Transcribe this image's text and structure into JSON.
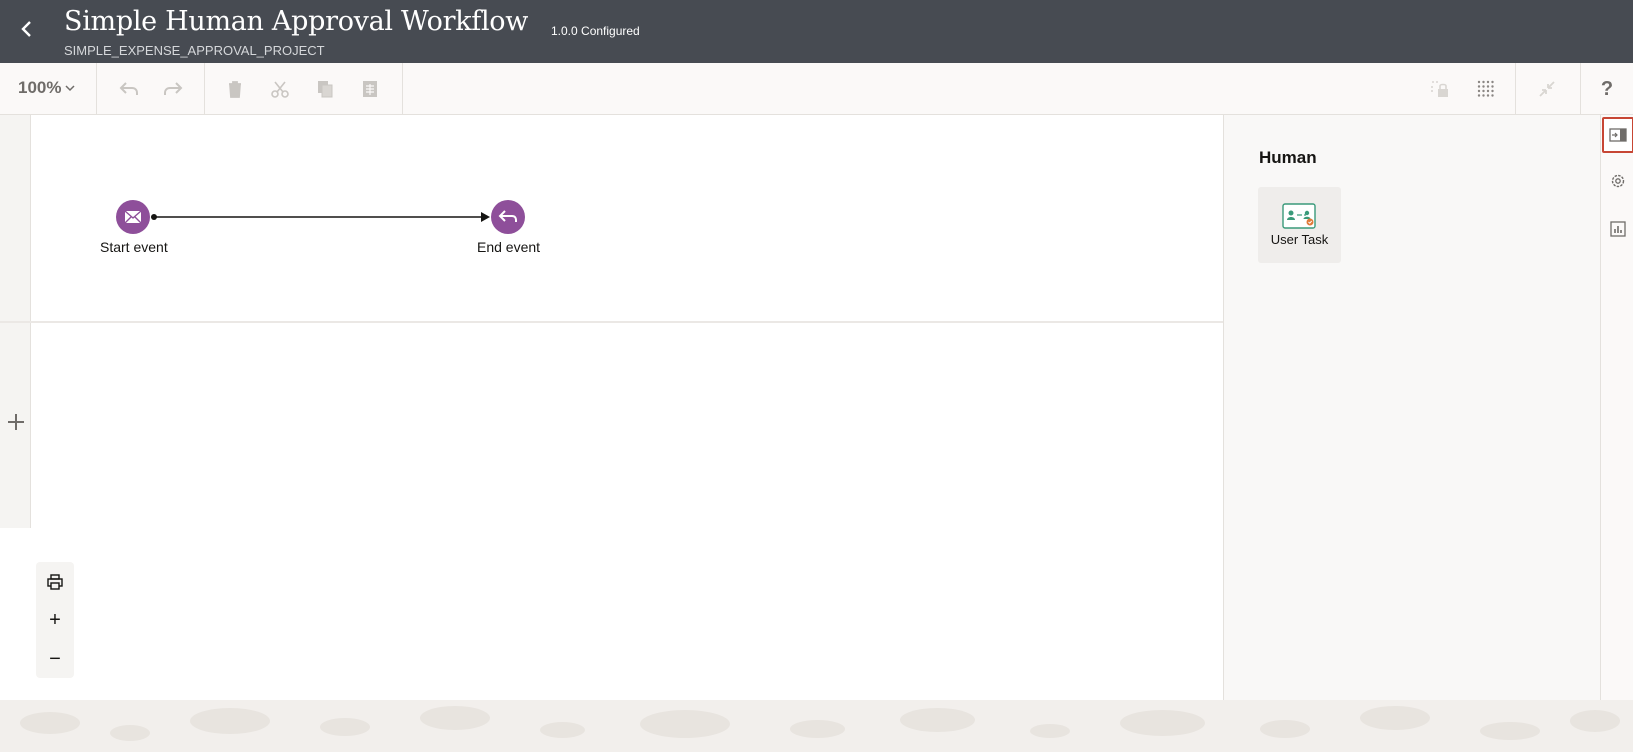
{
  "header": {
    "title": "Simple Human Approval Workflow",
    "subtitle": "SIMPLE_EXPENSE_APPROVAL_PROJECT",
    "version": "1.0.0 Configured",
    "back_icon": "chevron-left-icon"
  },
  "toolbar": {
    "zoom_value": "100%",
    "buttons": [
      "undo-icon",
      "redo-icon",
      "delete-icon",
      "cut-icon",
      "copy-icon",
      "paste-icon",
      "lock-icon",
      "grid-icon",
      "collapse-icon"
    ],
    "help_label": "?"
  },
  "canvas": {
    "start_event": {
      "label": "Start event",
      "icon": "envelope-icon"
    },
    "end_event": {
      "label": "End event",
      "icon": "return-arrow-icon"
    },
    "add_lane_label": "+",
    "zoom_in_label": "+",
    "zoom_out_label": "−"
  },
  "palette": {
    "heading": "Human",
    "items": [
      {
        "label": "User Task",
        "icon": "user-task-icon"
      }
    ]
  },
  "side_rail": {
    "buttons": [
      "palette-toggle-icon",
      "settings-icon",
      "chart-icon"
    ]
  },
  "colors": {
    "header_bg": "#474b52",
    "event_purple": "#8e4f9a",
    "highlight_red": "#c74634"
  }
}
